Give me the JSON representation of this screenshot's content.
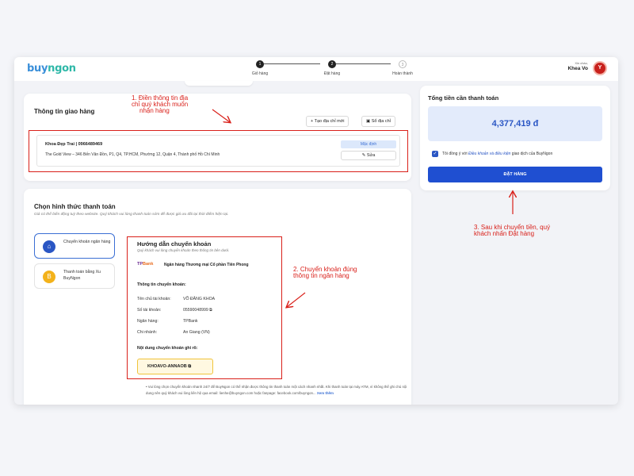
{
  "header": {
    "logo_main": "buy",
    "logo_accent": "ngon",
    "steps": [
      {
        "num": "1",
        "label": "Giỏ hàng",
        "done": true
      },
      {
        "num": "2",
        "label": "Đặt hàng",
        "done": true
      },
      {
        "num": "3",
        "label": "Hoàn thành",
        "done": false
      }
    ],
    "greeting": "Xin chào,",
    "username": "Khea Vo",
    "avatar_letter": "Y"
  },
  "shipping": {
    "title": "Thông tin giao hàng",
    "new_address_button": "Tạo địa chỉ mới",
    "address_book_button": "Sổ địa chỉ",
    "name_phone": "Khoa Đẹp Trai   |   0966489469",
    "address": "The Gold View – 346 Bến Vân Đồn, P1, Q4, TP.HCM, Phường 12, Quận 4, Thành phố Hồ Chí Minh",
    "default_badge": "Mặc định",
    "edit_button": "Sửa"
  },
  "payment": {
    "title": "Chọn hình thức thanh toán",
    "subtitle": "Giá có thể biến động tuỳ theo website. Quý khách vui lòng thanh toán sớm để được giá ưu đãi tại thời điểm hiện tại.",
    "methods": [
      {
        "label": "Chuyển khoản ngân hàng",
        "active": true
      },
      {
        "label": "Thanh toán bằng Xu BuyNgon",
        "active": false
      }
    ],
    "guide": {
      "title": "Hướng dẫn chuyển khoản",
      "subtitle": "Quý khách vui lòng chuyển khoản theo thông tin bên dưới.",
      "bank_logo_tp": "TP",
      "bank_logo_bank": "Bank",
      "bank_full_name": "Ngân hàng Thương mại Cổ phần Tiên Phong",
      "transfer_info_title": "Thông tin chuyển khoản:",
      "rows": [
        {
          "label": "Tên chủ tài khoản:",
          "value": "VÕ ĐĂNG KHOA"
        },
        {
          "label": "Số tài khoản:",
          "value": "05590048999 ⧉"
        },
        {
          "label": "Ngân hàng:",
          "value": "TPBank"
        },
        {
          "label": "Chi nhánh:",
          "value": "An Giang (VN)"
        }
      ],
      "note_title": "Nội dung chuyển khoản ghi rõ:",
      "note_code": "KHOAVO-ANNAOB ⧉"
    },
    "fine_print": "• Vui lòng chọn chuyển khoản nhanh 24/7 để BuyNgon có thể nhận được thông tin thanh toán một cách nhanh nhất. Khi thanh toán tại máy ATM, vì không thể ghi chú nội dung nên quý khách vui lòng liên hệ qua email: lienhe@buyngon.com hoặc fanpage: facebook.com/buyngon...",
    "fine_print_more": "Xem thêm"
  },
  "summary": {
    "title": "Tổng tiền cần thanh toán",
    "amount": "4,377,419 đ",
    "agree_prefix": "Tôi đồng ý với",
    "agree_link": "Điều khoản và điều kiện",
    "agree_suffix": "giao dịch của BuyNgon",
    "order_button": "ĐẶT HÀNG"
  },
  "annotations": {
    "step1": [
      "1. Điền thông tin địa",
      "chỉ quý khách muốn",
      "nhận hàng"
    ],
    "step2": [
      "2. Chuyển khoản đúng",
      "thông tin ngân hàng"
    ],
    "step3": [
      "3. Sau khi chuyển tiền, quý",
      "khách nhấn Đặt hàng"
    ]
  },
  "colors": {
    "accent": "#1f4fd1",
    "highlight": "#d9201a",
    "amount": "#2a56c4"
  }
}
